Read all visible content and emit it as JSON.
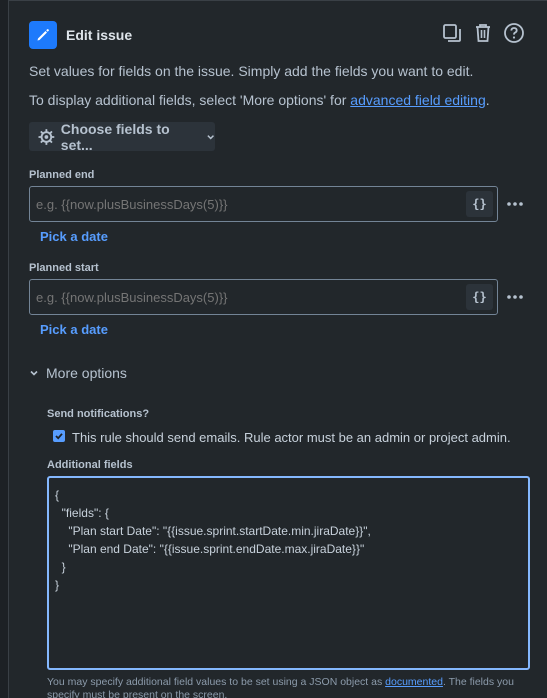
{
  "header": {
    "title": "Edit issue"
  },
  "description": {
    "line1": "Set values for fields on the issue. Simply add the fields you want to edit.",
    "line2_prefix": "To display additional fields, select 'More options' for ",
    "line2_link": "advanced field editing",
    "line2_suffix": "."
  },
  "choose_fields": {
    "label": "Choose fields to set..."
  },
  "fields": [
    {
      "label": "Planned end",
      "placeholder": "e.g. {{now.plusBusinessDays(5)}}",
      "smart_value_label": "{}",
      "pick_date_label": "Pick a date"
    },
    {
      "label": "Planned start",
      "placeholder": "e.g. {{now.plusBusinessDays(5)}}",
      "smart_value_label": "{}",
      "pick_date_label": "Pick a date"
    }
  ],
  "more_options": {
    "label": "More options",
    "send_notifications_label": "Send notifications?",
    "send_notifications_checked": true,
    "send_notifications_text": "This rule should send emails. Rule actor must be an admin or project admin.",
    "additional_fields_label": "Additional fields",
    "additional_fields_value": "{\n  \"fields\": {\n    \"Plan start Date\": \"{{issue.sprint.startDate.min.jiraDate}}\",\n    \"Plan end Date\": \"{{issue.sprint.endDate.max.jiraDate}}\"\n  }\n}",
    "footnote_prefix": "You may specify additional field values to be set using a JSON object as ",
    "footnote_link": "documented",
    "footnote_suffix": ". The fields you specify must be present on the screen."
  },
  "colors": {
    "accent": "#579dff",
    "action_icon_bg": "#1d7afc",
    "panel_bg": "#22272b"
  }
}
